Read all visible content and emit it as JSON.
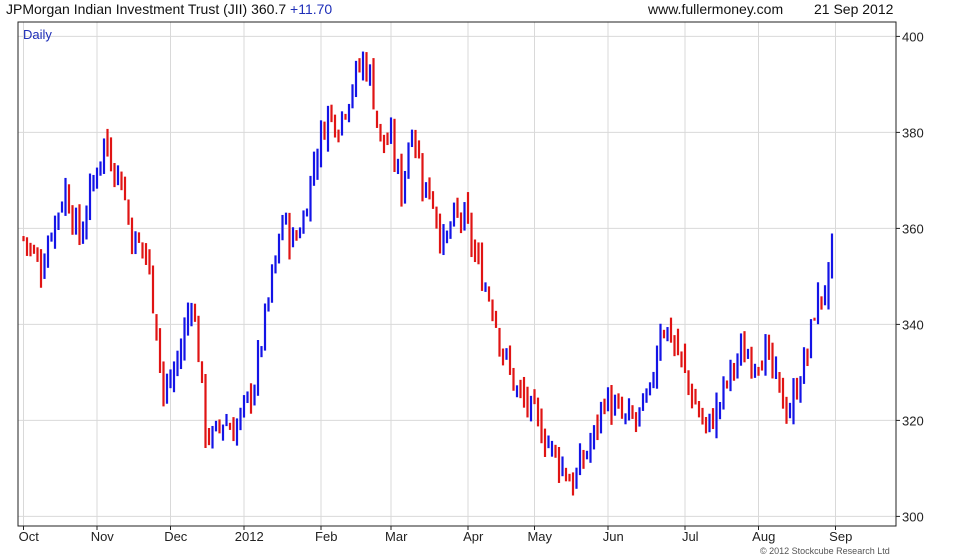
{
  "header": {
    "title": "JPMorgan Indian Investment Trust (JII) 360.7",
    "change": "+11.70",
    "source": "www.fullermoney.com",
    "date": "21 Sep 2012"
  },
  "footer": {
    "copyright": "© 2012 Stockcube Research Ltd"
  },
  "colors": {
    "up": "#1414e6",
    "down": "#e01414",
    "grid": "#d9d9d9",
    "label": "#1f2fb8"
  },
  "chart_data": {
    "type": "bar",
    "period_label": "Daily",
    "ylim": [
      298,
      403
    ],
    "yticks": [
      300,
      320,
      340,
      360,
      380,
      400
    ],
    "month_labels": [
      {
        "label": "Oct",
        "index": 1.5
      },
      {
        "label": "Nov",
        "index": 22.5
      },
      {
        "label": "Dec",
        "index": 43.5
      },
      {
        "label": "2012",
        "index": 64.5
      },
      {
        "label": "Feb",
        "index": 86.5
      },
      {
        "label": "Mar",
        "index": 106.5
      },
      {
        "label": "Apr",
        "index": 128.5
      },
      {
        "label": "May",
        "index": 147.5
      },
      {
        "label": "Jun",
        "index": 168.5
      },
      {
        "label": "Jul",
        "index": 190.5
      },
      {
        "label": "Aug",
        "index": 211.5
      },
      {
        "label": "Sep",
        "index": 233.5
      }
    ],
    "trend": [
      [
        0,
        358
      ],
      [
        5,
        352
      ],
      [
        8,
        360
      ],
      [
        12,
        368
      ],
      [
        16,
        358
      ],
      [
        20,
        370
      ],
      [
        23,
        378
      ],
      [
        28,
        370
      ],
      [
        31,
        358
      ],
      [
        35,
        355
      ],
      [
        38,
        340
      ],
      [
        40,
        325
      ],
      [
        42,
        328
      ],
      [
        45,
        335
      ],
      [
        48,
        346
      ],
      [
        50,
        334
      ],
      [
        52,
        318
      ],
      [
        54,
        316
      ],
      [
        57,
        320
      ],
      [
        60,
        318
      ],
      [
        63,
        322
      ],
      [
        66,
        328
      ],
      [
        70,
        345
      ],
      [
        74,
        362
      ],
      [
        77,
        357
      ],
      [
        80,
        362
      ],
      [
        83,
        374
      ],
      [
        87,
        384
      ],
      [
        90,
        382
      ],
      [
        94,
        390
      ],
      [
        97,
        395
      ],
      [
        99,
        392
      ],
      [
        102,
        378
      ],
      [
        105,
        378
      ],
      [
        108,
        368
      ],
      [
        111,
        382
      ],
      [
        114,
        370
      ],
      [
        117,
        366
      ],
      [
        120,
        356
      ],
      [
        123,
        362
      ],
      [
        126,
        362
      ],
      [
        130,
        352
      ],
      [
        134,
        344
      ],
      [
        137,
        334
      ],
      [
        141,
        326
      ],
      [
        145,
        322
      ],
      [
        148,
        318
      ],
      [
        151,
        314
      ],
      [
        155,
        309
      ],
      [
        157,
        307
      ],
      [
        160,
        312
      ],
      [
        163,
        317
      ],
      [
        166,
        325
      ],
      [
        169,
        322
      ],
      [
        172,
        320
      ],
      [
        175,
        320
      ],
      [
        179,
        325
      ],
      [
        182,
        340
      ],
      [
        185,
        338
      ],
      [
        188,
        332
      ],
      [
        191,
        325
      ],
      [
        195,
        318
      ],
      [
        198,
        322
      ],
      [
        202,
        330
      ],
      [
        205,
        334
      ],
      [
        209,
        333
      ],
      [
        212,
        334
      ],
      [
        214,
        330
      ],
      [
        217,
        324
      ],
      [
        219,
        322
      ],
      [
        222,
        330
      ],
      [
        224,
        334
      ],
      [
        226,
        343
      ],
      [
        228,
        346
      ],
      [
        230,
        349
      ],
      [
        231,
        356
      ]
    ]
  }
}
